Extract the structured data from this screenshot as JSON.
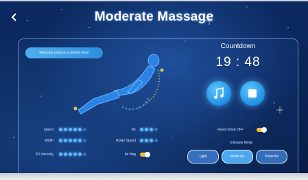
{
  "header": {
    "title": "Moderate Massage"
  },
  "status": {
    "badge": "Massage posture scanning done"
  },
  "countdown": {
    "label": "Countdown",
    "time": "19 : 48"
  },
  "settings": {
    "speed": {
      "label": "Speed",
      "level": 5,
      "max": 6
    },
    "width": {
      "label": "Width",
      "level": 5,
      "max": 6
    },
    "intensity_3d": {
      "label": "3D Intensity",
      "level": 5,
      "max": 6
    },
    "air": {
      "label": "Air",
      "level": 3,
      "max": 4
    },
    "roller_speed": {
      "label": "Roller Speed",
      "level": 3,
      "max": 4
    },
    "air_bag": {
      "label": "Air Bag",
      "on": true
    },
    "reset_when_off": {
      "label": "Reset when OFF",
      "on": true
    }
  },
  "intensity_mode": {
    "label": "Intensity Mode",
    "options": [
      "Light",
      "Moderate",
      "Powerful"
    ],
    "selected": "Moderate"
  },
  "colors": {
    "accent": "#4aa8f0",
    "toggle_on": "#f2b93a",
    "background": "#0c2a62"
  },
  "icons": {
    "back": "chevron-left-icon",
    "music": "music-note-icon",
    "stop": "stop-square-icon"
  }
}
